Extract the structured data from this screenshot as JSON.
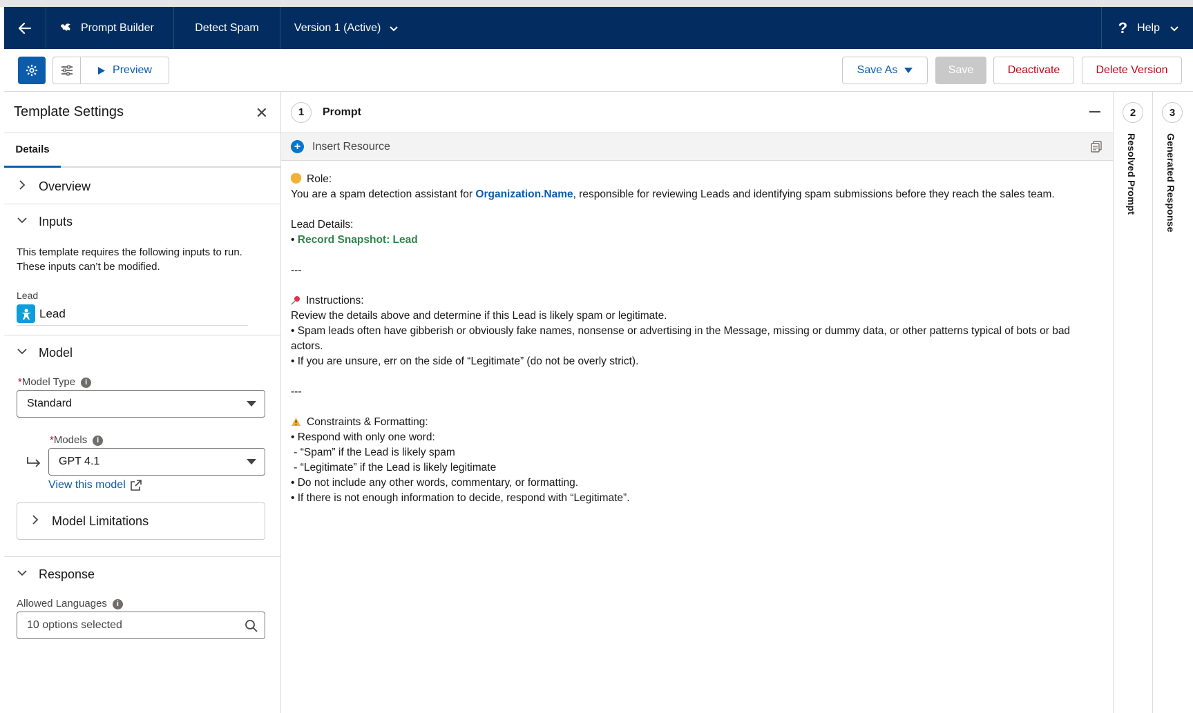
{
  "topbar": {
    "app_title": "Prompt Builder",
    "template_name": "Detect Spam",
    "version": "Version 1 (Active)",
    "help": "Help"
  },
  "toolbar": {
    "preview": "Preview",
    "save_as": "Save As",
    "save": "Save",
    "deactivate": "Deactivate",
    "delete_version": "Delete Version"
  },
  "left_panel": {
    "title": "Template Settings",
    "tab_details": "Details",
    "overview": "Overview",
    "inputs": {
      "heading": "Inputs",
      "description": "This template requires the following inputs to run. These inputs can’t be modified.",
      "lead_label": "Lead",
      "lead_value": "Lead"
    },
    "model": {
      "heading": "Model",
      "model_type_label": "Model Type",
      "model_type_value": "Standard",
      "models_label": "Models",
      "models_value": "GPT 4.1",
      "view_model_link": "View this model",
      "limitations": "Model Limitations"
    },
    "response": {
      "heading": "Response",
      "allowed_languages_label": "Allowed Languages",
      "allowed_languages_value": "10 options selected"
    }
  },
  "prompt": {
    "step": "1",
    "title": "Prompt",
    "insert_resource": "Insert Resource",
    "role_heading": "Role:",
    "role_pre": "You are a spam detection assistant for ",
    "role_merge": "Organization.Name",
    "role_post": ", responsible for reviewing Leads and identifying spam submissions before they reach the sales team.",
    "lead_details": "Lead Details:",
    "bullet": "•",
    "record_snapshot": "Record Snapshot: Lead",
    "separator": "---",
    "instructions_heading": "Instructions:",
    "instr_line1": "Review the details above and determine if this Lead is likely spam or legitimate.",
    "instr_line2": "• Spam leads often have gibberish or obviously fake names, nonsense or advertising in the Message, missing or dummy data, or other patterns typical of bots or bad actors.",
    "instr_line3": "• If you are unsure, err on the side of “Legitimate” (do not be overly strict).",
    "constraints_heading": "Constraints & Formatting:",
    "c1": "• Respond with only one word:",
    "c2": " - “Spam” if the Lead is likely spam",
    "c3": " - “Legitimate” if the Lead is likely legitimate",
    "c4": "• Do not include any other words, commentary, or formatting.",
    "c5": "• If there is not enough information to decide, respond with “Legitimate”."
  },
  "rails": {
    "resolved_num": "2",
    "resolved": "Resolved Prompt",
    "generated_num": "3",
    "generated": "Generated Response"
  }
}
